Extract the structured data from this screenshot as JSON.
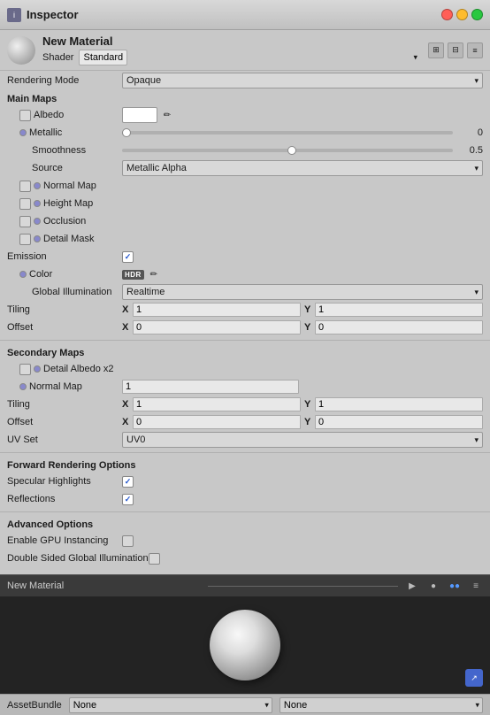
{
  "window": {
    "title": "Inspector",
    "icon_label": "i"
  },
  "object": {
    "name": "New Material",
    "shader_label": "Shader",
    "shader_value": "Standard"
  },
  "rendering": {
    "label": "Rendering Mode",
    "value": "Opaque"
  },
  "main_maps": {
    "header": "Main Maps",
    "albedo_label": "Albedo",
    "metallic_label": "Metallic",
    "metallic_value": "0",
    "smoothness_label": "Smoothness",
    "smoothness_value": "0.5",
    "smoothness_pct": 50,
    "source_label": "Source",
    "source_value": "Metallic Alpha",
    "normal_map_label": "Normal Map",
    "height_map_label": "Height Map",
    "occlusion_label": "Occlusion",
    "detail_mask_label": "Detail Mask",
    "emission_label": "Emission",
    "color_label": "Color",
    "hdr_label": "HDR",
    "global_illum_label": "Global Illumination",
    "global_illum_value": "Realtime",
    "tiling_label": "Tiling",
    "tiling_x_label": "X",
    "tiling_x_value": "1",
    "tiling_y_label": "Y",
    "tiling_y_value": "1",
    "offset_label": "Offset",
    "offset_x_label": "X",
    "offset_x_value": "0",
    "offset_y_label": "Y",
    "offset_y_value": "0"
  },
  "secondary_maps": {
    "header": "Secondary Maps",
    "detail_albedo_label": "Detail Albedo x2",
    "normal_map_label": "Normal Map",
    "normal_map_value": "1",
    "tiling_label": "Tiling",
    "tiling_x_label": "X",
    "tiling_x_value": "1",
    "tiling_y_label": "Y",
    "tiling_y_value": "1",
    "offset_label": "Offset",
    "offset_x_label": "X",
    "offset_x_value": "0",
    "offset_y_label": "Y",
    "offset_y_value": "0",
    "uv_set_label": "UV Set",
    "uv_set_value": "UV0"
  },
  "forward_rendering": {
    "header": "Forward Rendering Options",
    "specular_label": "Specular Highlights",
    "reflections_label": "Reflections"
  },
  "advanced": {
    "header": "Advanced Options",
    "gpu_label": "Enable GPU Instancing",
    "double_sided_label": "Double Sided Global Illumination"
  },
  "preview": {
    "title": "New Material"
  },
  "assetbundle": {
    "label": "AssetBundle",
    "value1": "None",
    "value2": "None"
  }
}
